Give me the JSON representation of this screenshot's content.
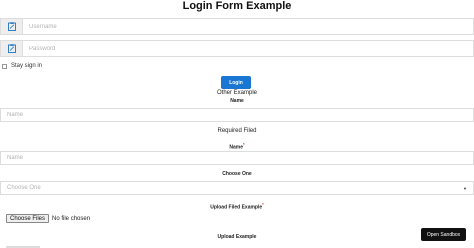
{
  "page": {
    "title": "Login Form Example"
  },
  "login_form": {
    "username_placeholder": "Username",
    "password_placeholder": "Password",
    "username_icon": "clipboard-icon",
    "password_icon": "clipboard-icon",
    "stay_signed_in_label": "Stay sign in",
    "login_button_label": "Login"
  },
  "other_example": {
    "label": "Other Example",
    "name_label": "Name",
    "name_placeholder": "Name"
  },
  "required_filed": {
    "label": "Required Filed",
    "name_label": "Name",
    "required_marker": "*",
    "name_placeholder": "Name"
  },
  "choose_one": {
    "label": "Choose One",
    "select_placeholder": "Choose One"
  },
  "upload_filed_example": {
    "label": "Upload Filed Example",
    "required_marker": "*",
    "choose_files_label": "Choose Files",
    "no_file_label": "No file chosen"
  },
  "upload_example": {
    "label": "Upload Example"
  },
  "sandbox": {
    "button_label": "Open Sandbox"
  },
  "colors": {
    "primary": "#1976d2",
    "required": "#d32f2f",
    "sandbox_bg": "#111111"
  }
}
